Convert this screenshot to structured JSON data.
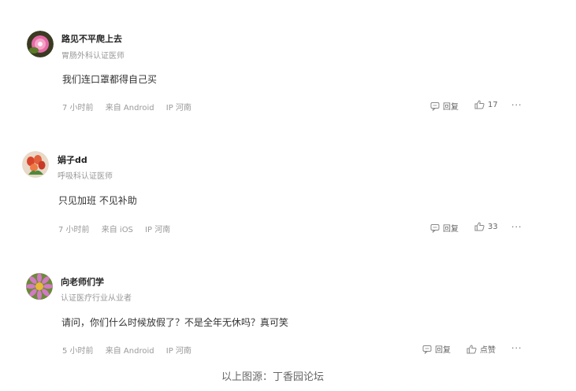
{
  "comments": [
    {
      "username": "路见不平爬上去",
      "role": "胃肠外科认证医师",
      "text": "我们连口罩都得自己买",
      "time": "7 小时前",
      "device": "来自 Android",
      "location": "IP 河南",
      "reply_label": "回复",
      "like_label": "17",
      "more_label": "···"
    },
    {
      "username": "娟子dd",
      "role": "呼吸科认证医师",
      "text": "只见加班 不见补助",
      "time": "7 小时前",
      "device": "来自 iOS",
      "location": "IP 河南",
      "reply_label": "回复",
      "like_label": "33",
      "more_label": "···"
    },
    {
      "username": "向老师们学",
      "role": "认证医疗行业从业者",
      "text": "请问，你们什么时候放假了？不是全年无休吗？真可笑",
      "time": "5 小时前",
      "device": "来自 Android",
      "location": "IP 河南",
      "reply_label": "回复",
      "like_label": "点赞",
      "more_label": "···"
    }
  ],
  "source_caption": "以上图源：丁香园论坛",
  "colors": {
    "meta": "#999999",
    "username": "#222222",
    "text": "#333333"
  }
}
